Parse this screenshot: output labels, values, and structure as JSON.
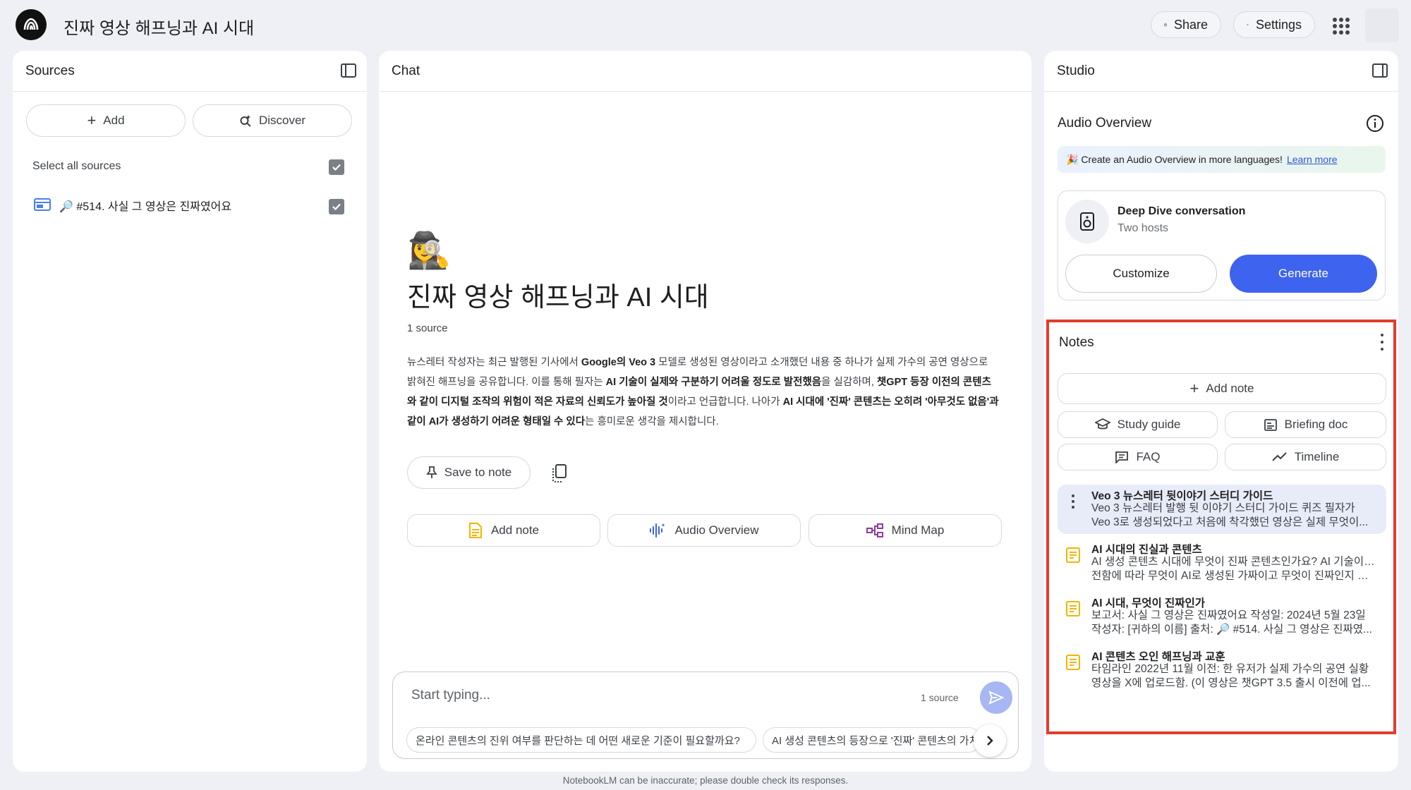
{
  "app": {
    "title": "진짜 영상 해프닝과 AI 시대",
    "share_label": "Share",
    "settings_label": "Settings"
  },
  "sources": {
    "header": "Sources",
    "add_label": "Add",
    "discover_label": "Discover",
    "select_all_label": "Select all sources",
    "select_all_checked": true,
    "items": [
      {
        "title": "🔎 #514. 사실 그 영상은 진짜였어요",
        "checked": true
      }
    ]
  },
  "chat": {
    "header": "Chat",
    "emoji": "🕵️‍♀️",
    "title": "진짜 영상 해프닝과 AI 시대",
    "source_count": "1 source",
    "summary_parts": [
      {
        "t": "뉴스레터 작성자는 최근 발행된 기사에서 ",
        "b": false
      },
      {
        "t": "Google의 Veo 3",
        "b": true
      },
      {
        "t": " 모델로 생성된 영상이라고 소개했던 내용 중 하나가 실제 가수의 공연 영상으로 밝혀진 해프닝을 공유합니다. 이를 통해 필자는 ",
        "b": false
      },
      {
        "t": "AI 기술이 실제와 구분하기 어려울 정도로 발전했음",
        "b": true
      },
      {
        "t": "을 실감하며, ",
        "b": false
      },
      {
        "t": "챗GPT 등장 이전의 콘텐츠와 같이 디지털 조작의 위험이 적은 자료의 신뢰도가 높아질 것",
        "b": true
      },
      {
        "t": "이라고 언급합니다. 나아가 ",
        "b": false
      },
      {
        "t": "AI 시대에 '진짜' 콘텐츠는 오히려 '아무것도 없음'과 같이 AI가 생성하기 어려운 형태일 수 있다",
        "b": true
      },
      {
        "t": "는 흥미로운 생각을 제시합니다.",
        "b": false
      }
    ],
    "save_to_note_label": "Save to note",
    "actions": {
      "add_note": "Add note",
      "audio_overview": "Audio Overview",
      "mind_map": "Mind Map"
    },
    "input": {
      "placeholder": "Start typing...",
      "source_count": "1 source"
    },
    "suggestions": [
      "온라인 콘텐츠의 진위 여부를 판단하는 데 어떤 새로운 기준이 필요할까요?",
      "AI 생성 콘텐츠의 등장으로 '진짜' 콘텐츠의 가치"
    ],
    "footer": "NotebookLM can be inaccurate; please double check its responses."
  },
  "studio": {
    "header": "Studio",
    "audio_overview_title": "Audio Overview",
    "banner_text": "🎉 Create an Audio Overview in more languages!",
    "banner_link": "Learn more",
    "deep_dive_title": "Deep Dive conversation",
    "deep_dive_subtitle": "Two hosts",
    "customize_label": "Customize",
    "generate_label": "Generate",
    "notes": {
      "title": "Notes",
      "add_note_label": "Add note",
      "tools": {
        "study_guide": "Study guide",
        "briefing_doc": "Briefing doc",
        "faq": "FAQ",
        "timeline": "Timeline"
      },
      "items": [
        {
          "title": "Veo 3 뉴스레터 뒷이야기 스터디 가이드",
          "line1": "Veo 3 뉴스레터 발행 뒷 이야기 스터디 가이드 퀴즈 필자가",
          "line2": "Veo 3로 생성되었다고 처음에 착각했던 영상은 실제 무엇이...",
          "icon": "more-vert-icon"
        },
        {
          "title": "AI 시대의 진실과 콘텐츠",
          "line1": "AI 생성 콘텐츠 시대에 무엇이 진짜 콘텐츠인가요? AI 기술이 발",
          "line2": "전함에 따라 무엇이 AI로 생성된 가짜이고 무엇이 진짜인지 구...",
          "icon": "note-icon"
        },
        {
          "title": "AI 시대, 무엇이 진짜인가",
          "line1": "보고서: 사실 그 영상은 진짜였어요 작성일: 2024년 5월 23일",
          "line2": "작성자: [귀하의 이름] 출처: 🔎 #514. 사실 그 영상은 진짜였...",
          "icon": "note-icon"
        },
        {
          "title": "AI 콘텐츠 오인 해프닝과 교훈",
          "line1": "타임라인 2022년 11월 이전: 한 유저가 실제 가수의 공연 실황",
          "line2": "영상을 X에 업로드함. (이 영상은 챗GPT 3.5 출시 이전에 업...",
          "icon": "note-icon"
        }
      ]
    }
  },
  "colors": {
    "accent": "#3e63ee",
    "highlight_border": "#e33b2e",
    "note_icon": "#f4b400"
  }
}
